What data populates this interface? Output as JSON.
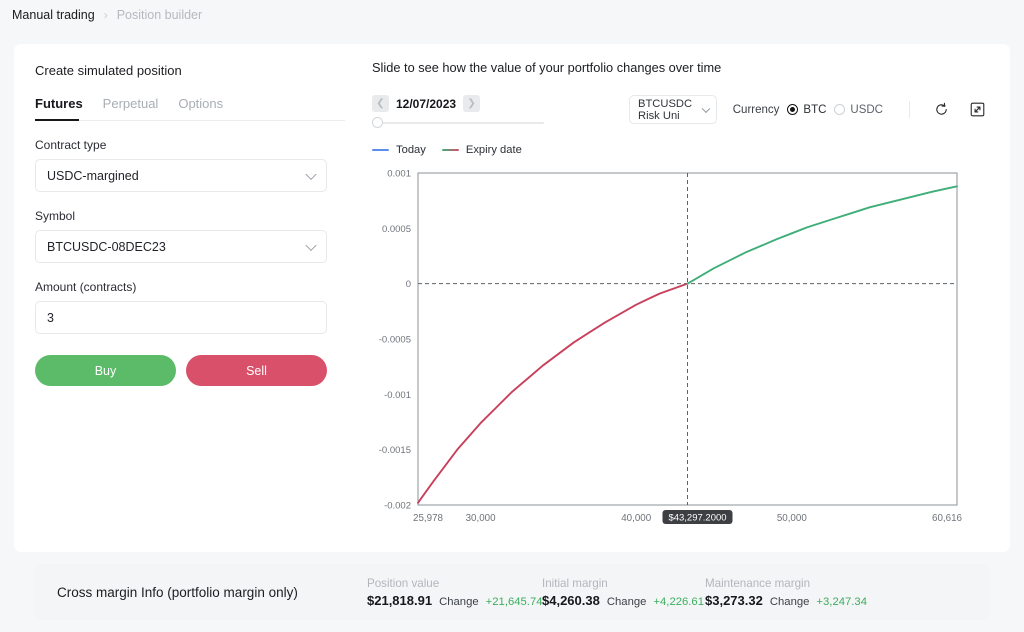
{
  "breadcrumb": {
    "current": "Manual trading",
    "separator": "›",
    "next": "Position builder"
  },
  "form": {
    "panel_title": "Create simulated position",
    "tabs": [
      {
        "label": "Futures",
        "active": true
      },
      {
        "label": "Perpetual",
        "active": false
      },
      {
        "label": "Options",
        "active": false
      }
    ],
    "contract_type": {
      "label": "Contract type",
      "value": "USDC-margined"
    },
    "symbol": {
      "label": "Symbol",
      "value": "BTCUSDC-08DEC23"
    },
    "amount": {
      "label": "Amount (contracts)",
      "value": "3"
    },
    "buy_label": "Buy",
    "sell_label": "Sell",
    "buy_color": "#5cbb68",
    "sell_color": "#d9506a"
  },
  "chart_panel": {
    "title": "Slide to see how the value of your portfolio changes over time",
    "date": "12/07/2023",
    "prev_icon": "chevron-left-icon",
    "next_icon": "chevron-right-icon",
    "slider_value": 0,
    "risk_unit": "BTCUSDC Risk Uni",
    "currency_label": "Currency",
    "currency_options": [
      {
        "label": "BTC",
        "selected": true
      },
      {
        "label": "USDC",
        "selected": false
      }
    ],
    "refresh_icon": "refresh-icon",
    "fullscreen_icon": "fullscreen-icon",
    "legend": [
      {
        "label": "Today",
        "color": "#5b8def"
      },
      {
        "label": "Expiry date",
        "color": "#3fae79"
      }
    ]
  },
  "chart_data": {
    "type": "line",
    "title": "",
    "xlabel": "",
    "ylabel": "",
    "xlim": [
      25978,
      60616
    ],
    "ylim": [
      -0.002,
      0.001
    ],
    "xticks": [
      25978,
      30000,
      40000,
      50000,
      60616
    ],
    "xtick_labels": [
      "25,978",
      "30,000",
      "40,000",
      "50,000",
      "60,616"
    ],
    "yticks": [
      0.001,
      0.0005,
      0,
      -0.0005,
      -0.001,
      -0.0015,
      -0.002
    ],
    "ytick_labels": [
      "0.001",
      "0.0005",
      "0",
      "-0.0005",
      "-0.001",
      "-0.0015",
      "-0.002"
    ],
    "grid": false,
    "crosshair_x": 43297.2,
    "crosshair_y": 0,
    "crosshair_label": "$43,297.2000",
    "legend_position": "above-left",
    "series": [
      {
        "name": "Expiry date (loss region)",
        "color": "#c8405c",
        "x": [
          25978,
          27000,
          28500,
          30000,
          32000,
          34000,
          36000,
          38000,
          40000,
          41500,
          43297.2
        ],
        "y": [
          -0.00198,
          -0.00178,
          -0.0015,
          -0.00126,
          -0.00098,
          -0.00074,
          -0.00053,
          -0.00035,
          -0.00019,
          -9e-05,
          0.0
        ]
      },
      {
        "name": "Expiry date (profit region)",
        "color": "#3fae79",
        "x": [
          43297.2,
          45000,
          47000,
          49000,
          51000,
          53000,
          55000,
          57000,
          59000,
          60616
        ],
        "y": [
          0.0,
          0.00014,
          0.00028,
          0.0004,
          0.00051,
          0.0006,
          0.00069,
          0.00076,
          0.00083,
          0.00088
        ]
      }
    ]
  },
  "margin_info": {
    "title": "Cross margin Info (portfolio margin only)",
    "change_label": "Change",
    "stats": [
      {
        "label": "Position value",
        "amount": "$21,818.91",
        "change": "+21,645.74"
      },
      {
        "label": "Initial margin",
        "amount": "$4,260.38",
        "change": "+4,226.61"
      },
      {
        "label": "Maintenance margin",
        "amount": "$3,273.32",
        "change": "+3,247.34"
      }
    ]
  }
}
